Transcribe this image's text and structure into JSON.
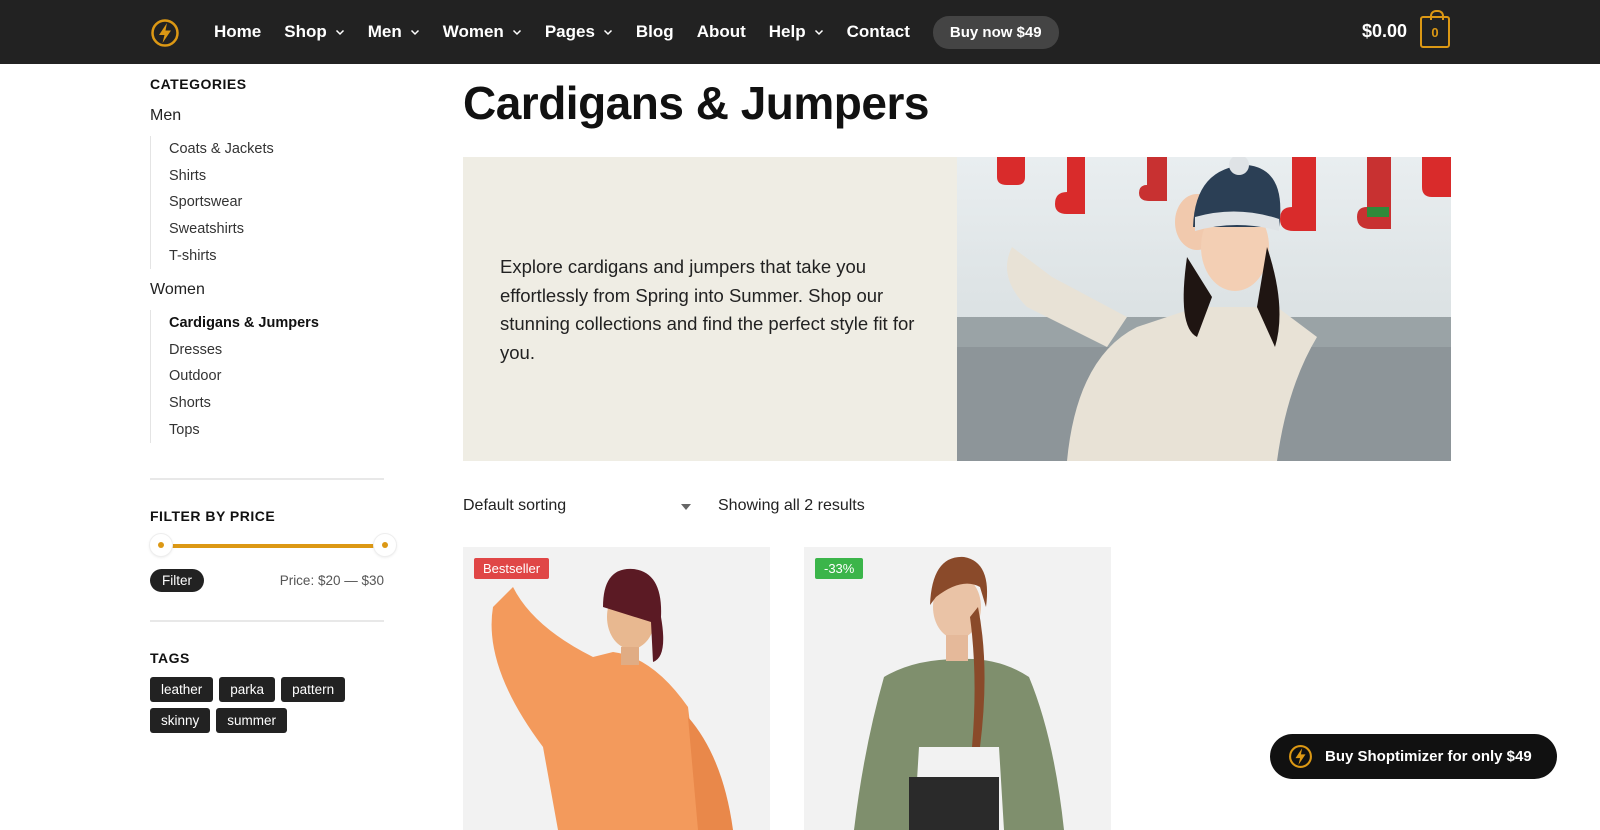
{
  "colors": {
    "accent": "#dc9814",
    "header_bg": "#222222",
    "bestseller_badge": "#e04646",
    "sale_badge": "#3bb54a"
  },
  "header": {
    "nav": [
      {
        "label": "Home",
        "has_dropdown": false
      },
      {
        "label": "Shop",
        "has_dropdown": true
      },
      {
        "label": "Men",
        "has_dropdown": true
      },
      {
        "label": "Women",
        "has_dropdown": true
      },
      {
        "label": "Pages",
        "has_dropdown": true
      },
      {
        "label": "Blog",
        "has_dropdown": false
      },
      {
        "label": "About",
        "has_dropdown": false
      },
      {
        "label": "Help",
        "has_dropdown": true
      },
      {
        "label": "Contact",
        "has_dropdown": false
      }
    ],
    "buy_label": "Buy now $49",
    "cart_total": "$0.00",
    "cart_count": "0"
  },
  "sidebar": {
    "categories_title": "CATEGORIES",
    "men_label": "Men",
    "men_items": [
      "Coats & Jackets",
      "Shirts",
      "Sportswear",
      "Sweatshirts",
      "T-shirts"
    ],
    "women_label": "Women",
    "women_items": [
      "Cardigans & Jumpers",
      "Dresses",
      "Outdoor",
      "Shorts",
      "Tops"
    ],
    "active_item": "Cardigans & Jumpers",
    "filter_title": "FILTER BY PRICE",
    "filter_button": "Filter",
    "price_range": "Price: $20 — $30",
    "tags_title": "TAGS",
    "tags": [
      "leather",
      "parka",
      "pattern",
      "skinny",
      "summer"
    ]
  },
  "main": {
    "title": "Cardigans & Jumpers",
    "description": "Explore cardigans and jumpers that take you effortlessly from Spring into Summer. Shop our stunning collections and find the perfect style fit for you.",
    "sorting": "Default sorting",
    "results": "Showing all 2 results",
    "products": [
      {
        "badge": "Bestseller",
        "badge_color": "red",
        "image": "orange-sweater-photo"
      },
      {
        "badge": "-33%",
        "badge_color": "green",
        "image": "green-sweater-photo"
      }
    ]
  },
  "floating_cta": {
    "label": "Buy Shoptimizer for only $49"
  }
}
